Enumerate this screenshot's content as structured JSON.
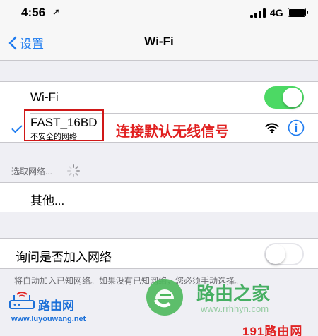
{
  "status_bar": {
    "time": "4:56",
    "location_glyph": "➚",
    "network": "4G"
  },
  "nav": {
    "back_label": "设置",
    "title": "Wi-Fi"
  },
  "wifi_group": {
    "wifi_label": "Wi-Fi",
    "wifi_enabled": true,
    "connected_network": {
      "name": "FAST_16BD",
      "subtitle": "不安全的网络"
    }
  },
  "annotation": {
    "text": "连接默认无线信号"
  },
  "networks_section": {
    "header": "选取网络...",
    "other_label": "其他..."
  },
  "ask_group": {
    "label": "询问是否加入网络",
    "enabled": false
  },
  "footer_text": "将自动加入已知网络。如果没有已知网络，您必须手动选择。",
  "watermark": {
    "brand_left": "路由网",
    "url_left": "www.luyouwang.net",
    "brand_center": "路由之家",
    "site_center": "www.rrhhyn.com",
    "footer": "191路由网"
  },
  "colors": {
    "accent": "#1f7cf0",
    "toggle_on": "#4cd964",
    "annotation_red": "#e12020"
  }
}
